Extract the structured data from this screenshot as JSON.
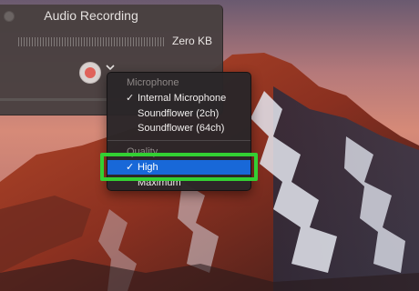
{
  "window": {
    "title": "Audio Recording",
    "file_size": "Zero KB"
  },
  "menu": {
    "microphone_heading": "Microphone",
    "microphone_items": [
      {
        "label": "Internal Microphone",
        "checked": true
      },
      {
        "label": "Soundflower (2ch)",
        "checked": false
      },
      {
        "label": "Soundflower (64ch)",
        "checked": false
      }
    ],
    "quality_heading": "Quality",
    "quality_items": [
      {
        "label": "High",
        "checked": true,
        "selected": true
      },
      {
        "label": "Maximum",
        "checked": false
      }
    ],
    "check_glyph": "✓"
  },
  "icons": {
    "close": "close-icon",
    "record": "record-icon",
    "options": "chevron-down-icon"
  },
  "colors": {
    "selection": "#1868d8",
    "annotation_frame": "#33d033",
    "record_dot": "#e0625a"
  }
}
